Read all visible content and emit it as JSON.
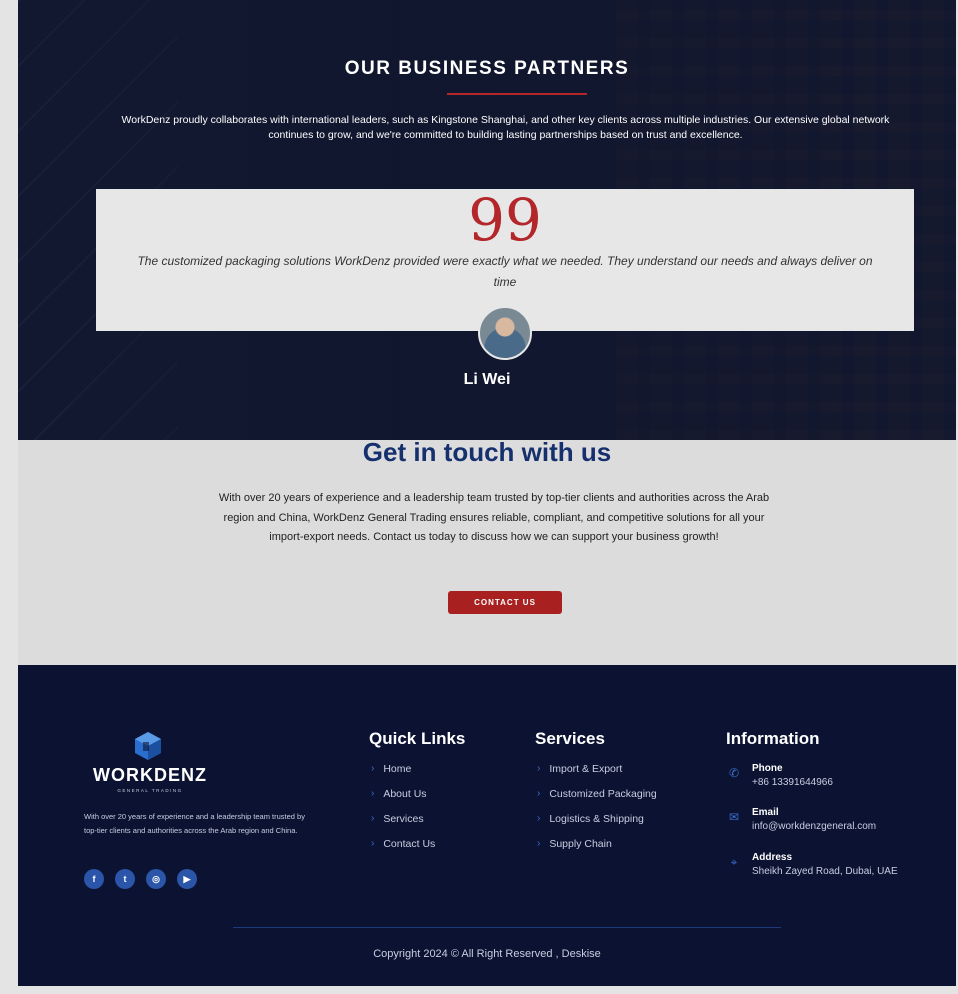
{
  "partners": {
    "title": "OUR BUSINESS PARTNERS",
    "description": "WorkDenz proudly collaborates with international leaders, such as Kingstone Shanghai, and other key clients across multiple industries. Our extensive global network continues to grow, and we're committed to building lasting partnerships based on trust and excellence.",
    "testimonial": {
      "quote_mark": "99",
      "text": "The customized packaging solutions WorkDenz provided were exactly what we needed. They understand our needs and always deliver on time",
      "name": "Li Wei"
    }
  },
  "contact": {
    "title": "Get in touch with us",
    "description": "With over 20 years of experience and a leadership team trusted by top-tier clients and authorities across the Arab region and China, WorkDenz General Trading ensures reliable, compliant, and competitive solutions for all your import-export needs. Contact us today to discuss how we can support your business growth!",
    "button_label": "CONTACT US"
  },
  "footer": {
    "logo_text": "WORKDENZ",
    "logo_sub": "GENERAL TRADING",
    "about": "With over 20 years of experience and a leadership team trusted by top-tier clients and authorities across the Arab region and China.",
    "socials": [
      {
        "icon": "facebook-icon",
        "glyph": "f"
      },
      {
        "icon": "twitter-icon",
        "glyph": "t"
      },
      {
        "icon": "instagram-icon",
        "glyph": "◎"
      },
      {
        "icon": "youtube-icon",
        "glyph": "▶"
      }
    ],
    "quick_links": {
      "title": "Quick Links",
      "items": [
        "Home",
        "About Us",
        "Services",
        "Contact Us"
      ]
    },
    "services": {
      "title": "Services",
      "items": [
        "Import & Export",
        "Customized Packaging",
        "Logistics & Shipping",
        "Supply Chain"
      ]
    },
    "information": {
      "title": "Information",
      "phone_label": "Phone",
      "phone": "+86 13391644966",
      "email_label": "Email",
      "email": "info@workdenzgeneral.com",
      "address_label": "Address",
      "address": "Sheikh Zayed Road, Dubai, UAE"
    },
    "copyright": "Copyright 2024 © All Right Reserved , Deskise"
  },
  "colors": {
    "accent_red": "#b3262a",
    "navy": "#0c1332",
    "brand_blue": "#2a55a8"
  }
}
